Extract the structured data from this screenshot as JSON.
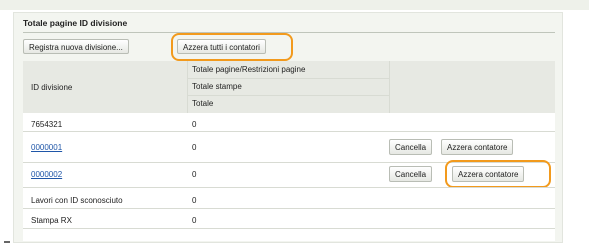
{
  "section": {
    "title": "Totale pagine ID divisione"
  },
  "toolbar": {
    "register_label": "Registra nuova divisione...",
    "reset_all_label": "Azzera tutti i contatori"
  },
  "table": {
    "headers": {
      "id": "ID divisione",
      "counts": [
        "Totale pagine/Restrizioni pagine",
        "Totale stampe",
        "Totale"
      ]
    },
    "rows": [
      {
        "id": "7654321",
        "total": "0",
        "link": false
      },
      {
        "id": "0000001",
        "total": "0",
        "link": true,
        "delete": "Cancella",
        "reset": "Azzera contatore"
      },
      {
        "id": "0000002",
        "total": "0",
        "link": true,
        "delete": "Cancella",
        "reset": "Azzera contatore"
      },
      {
        "id": "Lavori con ID sconosciuto",
        "total": "0",
        "link": false
      },
      {
        "id": "Stampa RX",
        "total": "0",
        "link": false
      }
    ]
  },
  "colors": {
    "highlight": "#f29a1d",
    "link": "#1f56a8"
  }
}
